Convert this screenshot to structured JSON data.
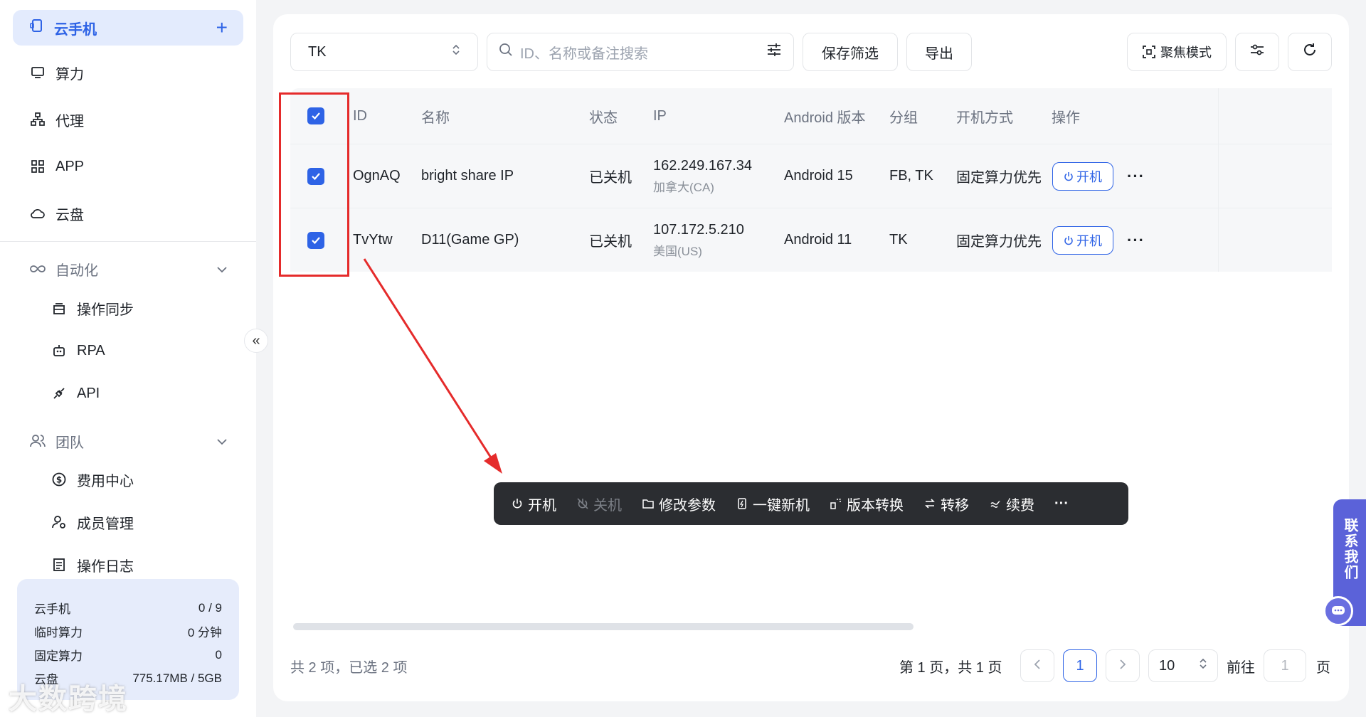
{
  "sidebar": {
    "active": {
      "label": "云手机",
      "plus": "+"
    },
    "items": [
      {
        "label": "算力",
        "icon": "monitor-icon"
      },
      {
        "label": "代理",
        "icon": "network-icon"
      },
      {
        "label": "APP",
        "icon": "apps-grid-icon"
      },
      {
        "label": "云盘",
        "icon": "cloud-icon"
      }
    ],
    "automation": {
      "label": "自动化",
      "icon": "infinity-icon",
      "children": [
        {
          "label": "操作同步",
          "icon": "sync-icon"
        },
        {
          "label": "RPA",
          "icon": "robot-icon"
        },
        {
          "label": "API",
          "icon": "plug-icon"
        }
      ]
    },
    "team": {
      "label": "团队",
      "icon": "users-icon",
      "children": [
        {
          "label": "费用中心",
          "icon": "dollar-icon"
        },
        {
          "label": "成员管理",
          "icon": "member-settings-icon"
        },
        {
          "label": "操作日志",
          "icon": "log-icon"
        }
      ]
    },
    "collapse": "«",
    "usage": [
      {
        "label": "云手机",
        "value": "0 / 9"
      },
      {
        "label": "临时算力",
        "value": "0 分钟"
      },
      {
        "label": "固定算力",
        "value": "0"
      },
      {
        "label": "云盘",
        "value": "775.17MB / 5GB"
      }
    ],
    "watermark": "大数跨境"
  },
  "toolbar": {
    "group_select": "TK",
    "search_placeholder": "ID、名称或备注搜索",
    "save_filter": "保存筛选",
    "export": "导出",
    "focus_mode": "聚焦模式"
  },
  "table": {
    "headers": {
      "id": "ID",
      "name": "名称",
      "status": "状态",
      "ip": "IP",
      "android": "Android 版本",
      "group": "分组",
      "boot": "开机方式",
      "ops": "操作"
    },
    "rows": [
      {
        "id": "OgnAQ",
        "name": "bright share IP",
        "status": "已关机",
        "ip": "162.249.167.34",
        "region": "加拿大(CA)",
        "android": "Android 15",
        "group": "FB, TK",
        "boot": "固定算力优先",
        "action": "开机"
      },
      {
        "id": "TvYtw",
        "name": "D11(Game GP)",
        "status": "已关机",
        "ip": "107.172.5.210",
        "region": "美国(US)",
        "android": "Android 11",
        "group": "TK",
        "boot": "固定算力优先",
        "action": "开机"
      }
    ]
  },
  "actionbar": {
    "power_on": "开机",
    "power_off": "关机",
    "edit_params": "修改参数",
    "new_device": "一键新机",
    "version_convert": "版本转换",
    "transfer": "转移",
    "renew": "续费",
    "more": "···"
  },
  "footer": {
    "total": "共 2 项，已选 2 项",
    "page_info": "第 1 页，共 1 页",
    "current_page": "1",
    "page_size": "10",
    "goto_label": "前往",
    "goto_value": "1",
    "page_suffix": "页"
  },
  "contact": {
    "label": "联系我们"
  },
  "colors": {
    "accent": "#2e63e6",
    "annotation_red": "#e52b2b",
    "actionbar_bg": "#2b2d31"
  }
}
